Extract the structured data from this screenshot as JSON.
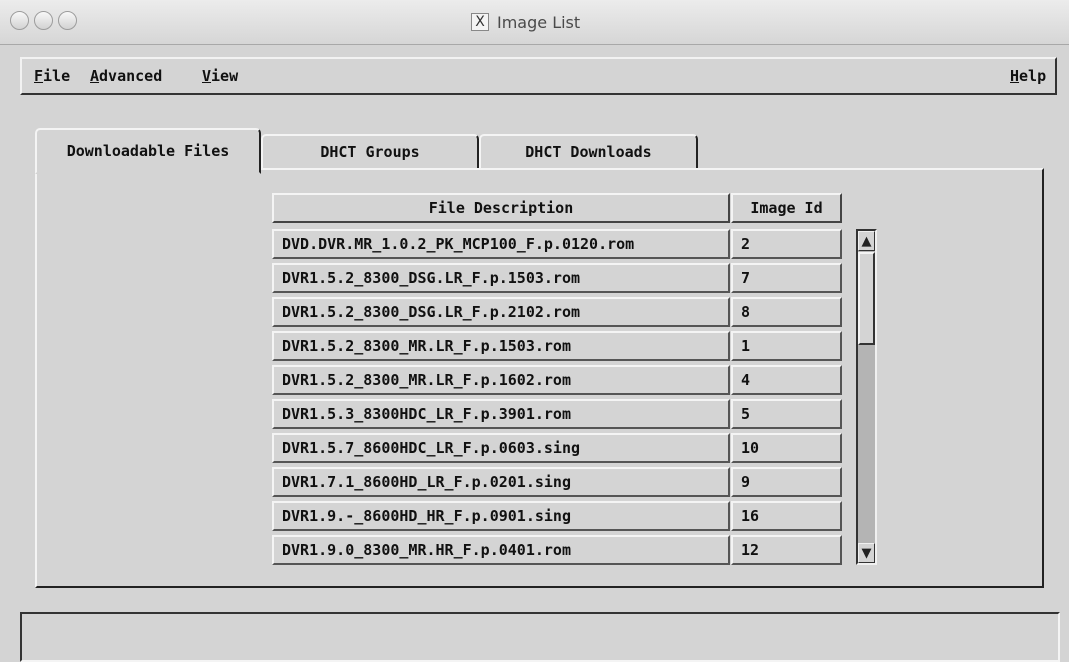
{
  "window": {
    "title": "Image List",
    "title_icon": "x11-icon"
  },
  "menubar": {
    "file": {
      "mnemonic": "F",
      "rest": "ile"
    },
    "advanced": {
      "mnemonic": "A",
      "rest": "dvanced"
    },
    "view": {
      "mnemonic": "V",
      "rest": "iew"
    },
    "help": {
      "mnemonic": "H",
      "rest": "elp"
    }
  },
  "tabs": [
    {
      "label": "Downloadable Files"
    },
    {
      "label": "DHCT Groups"
    },
    {
      "label": "DHCT Downloads"
    }
  ],
  "table": {
    "headers": {
      "description": "File Description",
      "image_id": "Image Id"
    },
    "rows": [
      {
        "description": "DVD.DVR.MR_1.0.2_PK_MCP100_F.p.0120.rom",
        "image_id": "2"
      },
      {
        "description": "DVR1.5.2_8300_DSG.LR_F.p.1503.rom",
        "image_id": "7"
      },
      {
        "description": "DVR1.5.2_8300_DSG.LR_F.p.2102.rom",
        "image_id": "8"
      },
      {
        "description": "DVR1.5.2_8300_MR.LR_F.p.1503.rom",
        "image_id": "1"
      },
      {
        "description": "DVR1.5.2_8300_MR.LR_F.p.1602.rom",
        "image_id": "4"
      },
      {
        "description": "DVR1.5.3_8300HDC_LR_F.p.3901.rom",
        "image_id": "5"
      },
      {
        "description": "DVR1.5.7_8600HDC_LR_F.p.0603.sing",
        "image_id": "10"
      },
      {
        "description": "DVR1.7.1_8600HD_LR_F.p.0201.sing",
        "image_id": "9"
      },
      {
        "description": "DVR1.9.-_8600HD_HR_F.p.0901.sing",
        "image_id": "16"
      },
      {
        "description": "DVR1.9.0_8300_MR.HR_F.p.0401.rom",
        "image_id": "12"
      }
    ]
  },
  "scrollbar": {
    "up_glyph": "▲",
    "down_glyph": "▼",
    "position": 0.0
  },
  "status_bar": {
    "text": ""
  }
}
